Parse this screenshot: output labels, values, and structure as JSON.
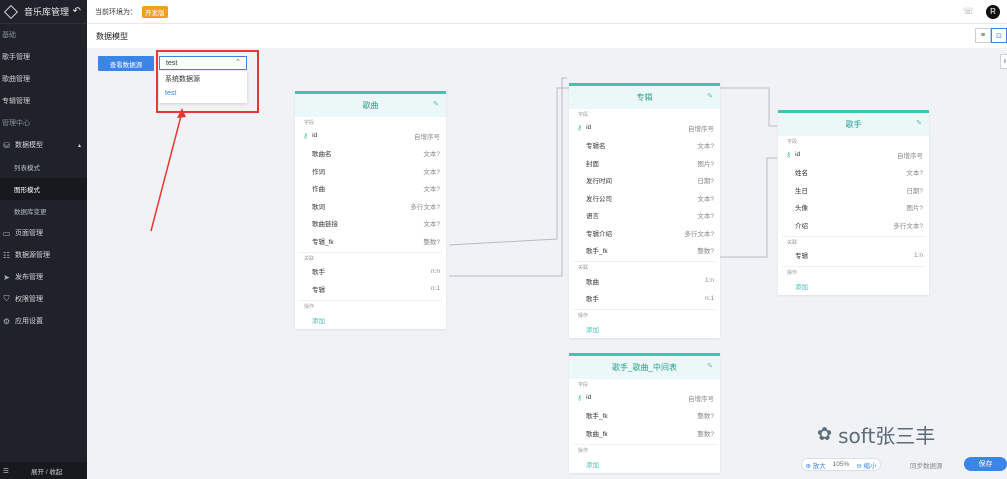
{
  "app": {
    "title": "音乐库管理"
  },
  "sidebar": {
    "groups": [
      {
        "label": "基础",
        "items": [
          {
            "label": "歌手管理"
          },
          {
            "label": "歌曲管理"
          },
          {
            "label": "专辑管理"
          }
        ]
      },
      {
        "label": "管理中心",
        "items": [
          {
            "label": "数据模型"
          },
          {
            "label": "列表模式"
          },
          {
            "label": "图形模式"
          },
          {
            "label": "数据库变更"
          },
          {
            "label": "页面管理"
          },
          {
            "label": "数据源管理"
          },
          {
            "label": "发布管理"
          },
          {
            "label": "权限管理"
          },
          {
            "label": "应用设置"
          }
        ]
      }
    ],
    "footer": "展开 / 收起"
  },
  "topbar": {
    "env_label": "当前环境为：",
    "env_badge": "开发版",
    "avatar": "R"
  },
  "page": {
    "title": "数据模型"
  },
  "toolbar": {
    "view_db_button": "查看数据源",
    "select_value": "test",
    "dropdown_options": [
      "系统数据源",
      "test"
    ]
  },
  "entities": [
    {
      "title": "歌曲",
      "sections": [
        {
          "label": "字段",
          "fields": [
            {
              "name": "id",
              "type": "自增序号",
              "pk": true
            },
            {
              "name": "歌曲名",
              "type": "文本?"
            },
            {
              "name": "作词",
              "type": "文本?"
            },
            {
              "name": "作曲",
              "type": "文本?"
            },
            {
              "name": "歌词",
              "type": "多行文本?"
            },
            {
              "name": "歌曲链接",
              "type": "文本?"
            },
            {
              "name": "专辑_fk",
              "type": "整数?"
            }
          ]
        },
        {
          "label": "关联",
          "fields": [
            {
              "name": "歌手",
              "type": "n:n"
            },
            {
              "name": "专辑",
              "type": "n:1"
            }
          ]
        },
        {
          "label": "操作",
          "add": "添加"
        }
      ]
    },
    {
      "title": "专辑",
      "sections": [
        {
          "label": "字段",
          "fields": [
            {
              "name": "id",
              "type": "自增序号",
              "pk": true
            },
            {
              "name": "专辑名",
              "type": "文本?"
            },
            {
              "name": "封面",
              "type": "图片?"
            },
            {
              "name": "发行时间",
              "type": "日期?"
            },
            {
              "name": "发行公司",
              "type": "文本?"
            },
            {
              "name": "语言",
              "type": "文本?"
            },
            {
              "name": "专辑介绍",
              "type": "多行文本?"
            },
            {
              "name": "歌手_fk",
              "type": "整数?"
            }
          ]
        },
        {
          "label": "关联",
          "fields": [
            {
              "name": "歌曲",
              "type": "1:n"
            },
            {
              "name": "歌手",
              "type": "n:1"
            }
          ]
        },
        {
          "label": "操作",
          "add": "添加"
        }
      ]
    },
    {
      "title": "歌手",
      "sections": [
        {
          "label": "字段",
          "fields": [
            {
              "name": "id",
              "type": "自增序号",
              "pk": true
            },
            {
              "name": "姓名",
              "type": "文本?"
            },
            {
              "name": "生日",
              "type": "日期?"
            },
            {
              "name": "头像",
              "type": "图片?"
            },
            {
              "name": "介绍",
              "type": "多行文本?"
            }
          ]
        },
        {
          "label": "关联",
          "fields": [
            {
              "name": "专辑",
              "type": "1:n"
            }
          ]
        },
        {
          "label": "操作",
          "add": "添加"
        }
      ]
    },
    {
      "title": "歌手_歌曲_中间表",
      "sections": [
        {
          "label": "字段",
          "fields": [
            {
              "name": "id",
              "type": "自增序号",
              "pk": true
            },
            {
              "name": "歌手_fk",
              "type": "整数?"
            },
            {
              "name": "歌曲_fk",
              "type": "整数?"
            }
          ]
        },
        {
          "label": "操作",
          "add": "添加"
        }
      ]
    }
  ],
  "footer": {
    "zoom_in": "放大",
    "zoom_pct": "105%",
    "zoom_out": "缩小",
    "sync": "同步数据源",
    "save": "保存"
  },
  "watermark": "soft张三丰",
  "colors": {
    "accent": "#3a85e6",
    "entity_teal": "#45c1b3",
    "annotation_red": "#e53935",
    "env_badge": "#f0a020"
  }
}
